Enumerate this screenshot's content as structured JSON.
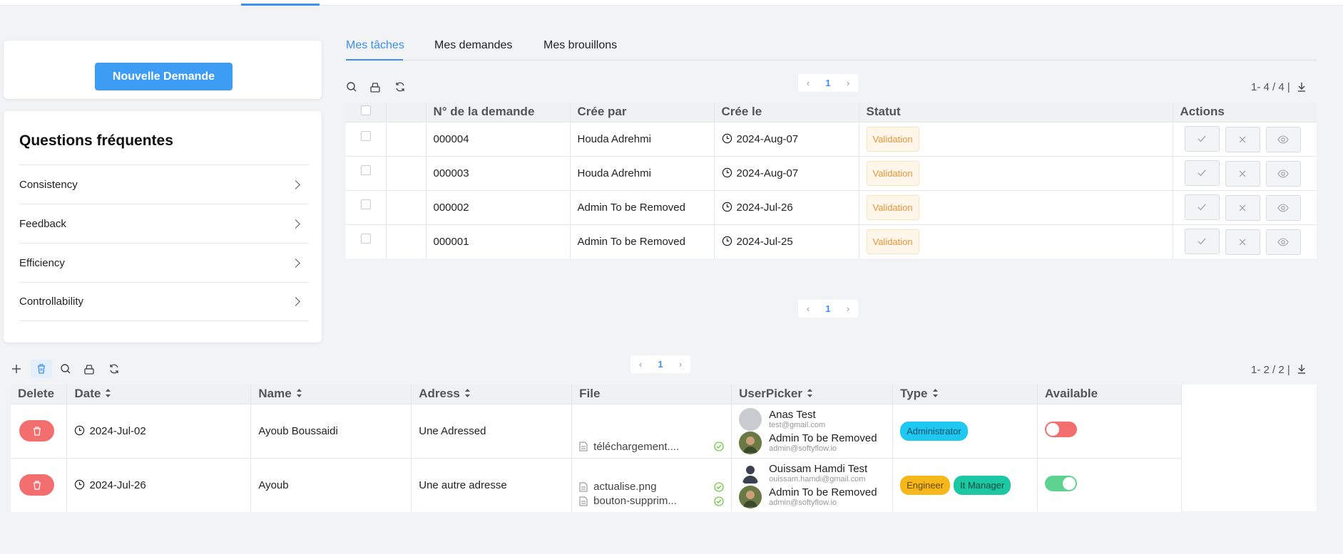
{
  "left_panel": {
    "new_request_label": "Nouvelle Demande",
    "faq_title": "Questions fréquentes",
    "faq_items": [
      "Consistency",
      "Feedback",
      "Efficiency",
      "Controllability"
    ]
  },
  "tabs": [
    "Mes tâches",
    "Mes demandes",
    "Mes brouillons"
  ],
  "tasks": {
    "page": "1",
    "count": "1- 4 / 4 |",
    "columns": [
      "N° de la demande",
      "Crée par",
      "Crée le",
      "Statut",
      "Actions"
    ],
    "rows": [
      {
        "num": "000004",
        "by": "Houda Adrehmi",
        "date": "2024-Aug-07",
        "status": "Validation"
      },
      {
        "num": "000003",
        "by": "Houda Adrehmi",
        "date": "2024-Aug-07",
        "status": "Validation"
      },
      {
        "num": "000002",
        "by": "Admin To be Removed",
        "date": "2024-Jul-26",
        "status": "Validation"
      },
      {
        "num": "000001",
        "by": "Admin To be Removed",
        "date": "2024-Jul-25",
        "status": "Validation"
      }
    ],
    "bottom_page": "1"
  },
  "grid": {
    "page": "1",
    "count": "1- 2 / 2 |",
    "columns": [
      "Delete",
      "Date",
      "Name",
      "Adress",
      "File",
      "UserPicker",
      "Type",
      "Available"
    ],
    "rows": [
      {
        "date": "2024-Jul-02",
        "name": "Ayoub Boussaidi",
        "adress": "Une Adressed",
        "files": [
          "téléchargement...."
        ],
        "users": [
          {
            "name": "Anas Test",
            "email": "test@gmail.com"
          },
          {
            "name": "Admin To be Removed",
            "email": "admin@softyflow.io"
          }
        ],
        "types": [
          "Administrator"
        ],
        "available": false
      },
      {
        "date": "2024-Jul-26",
        "name": "Ayoub",
        "adress": "Une autre adresse",
        "files": [
          "actualise.png",
          "bouton-supprim..."
        ],
        "users": [
          {
            "name": "Ouissam Hamdi Test",
            "email": "ouissam.hamdi@gmail.com"
          },
          {
            "name": "Admin To be Removed",
            "email": "admin@softyflow.io"
          }
        ],
        "types": [
          "Engineer",
          "It Manager"
        ],
        "available": true
      }
    ]
  },
  "colors": {
    "primary": "#3d9df5",
    "tag_administrator": "#1ec8f0",
    "tag_engineer": "#f5b71a",
    "tag_it_manager": "#1cc7a4",
    "toggle_off": "#f36f6f",
    "toggle_on": "#5ed38f",
    "delete": "#f36f6f"
  }
}
